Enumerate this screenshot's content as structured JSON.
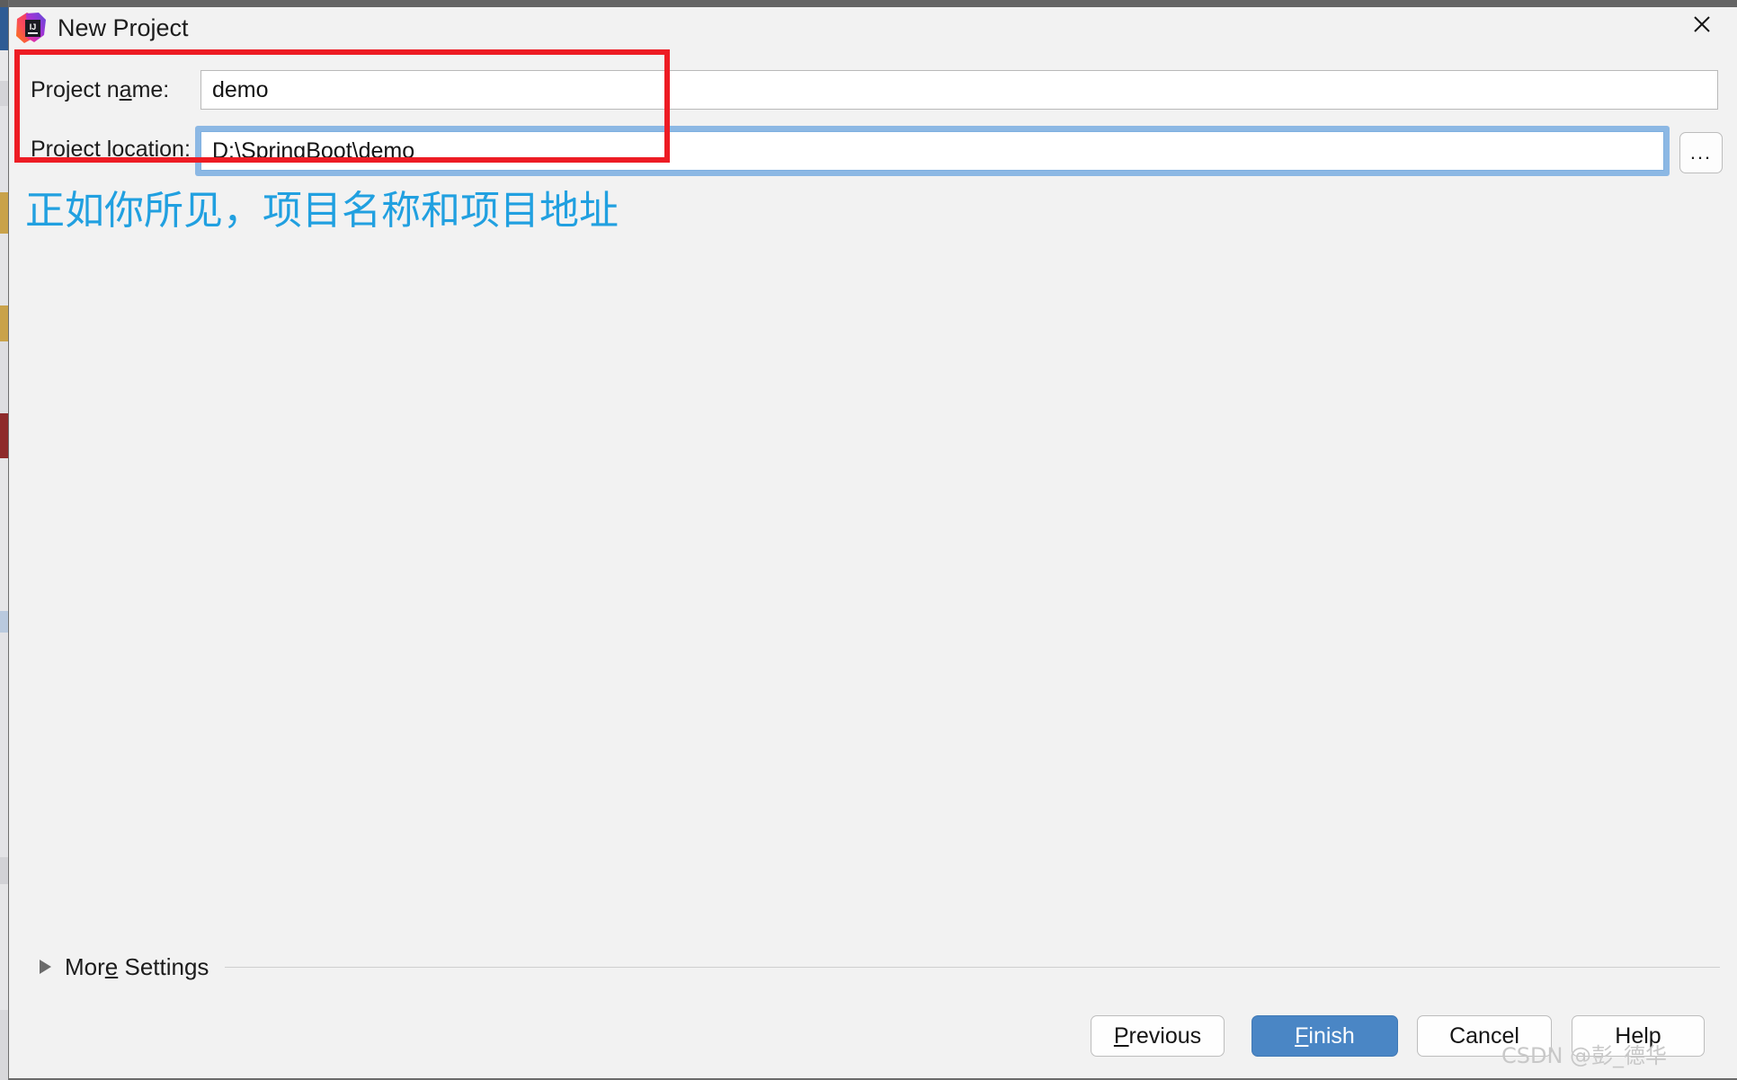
{
  "window": {
    "title": "New Project",
    "app_icon": "intellij-idea-logo",
    "close_icon": "close-icon"
  },
  "form": {
    "project_name": {
      "label_pre": "Project n",
      "label_mnemonic": "a",
      "label_post": "me:",
      "value": "demo",
      "placeholder": ""
    },
    "project_location": {
      "label_pre": "Project ",
      "label_mnemonic": "l",
      "label_post": "ocation:",
      "value": "D:\\SpringBoot\\demo",
      "placeholder": "",
      "browse_label": "...",
      "browse_icon": "ellipsis-icon"
    }
  },
  "annotation": {
    "note_text": "正如你所见，项目名称和项目地址",
    "note_color": "#21a0e0",
    "box_color": "#ed1c24"
  },
  "more_settings": {
    "label_pre": "Mor",
    "label_mnemonic": "e",
    "label_post": " Settings",
    "expander_icon": "chevron-right-icon",
    "expanded": false
  },
  "buttons": {
    "previous": {
      "mnemonic": "P",
      "rest": "revious"
    },
    "finish": {
      "mnemonic": "F",
      "rest": "inish",
      "primary": true,
      "color": "#4a86c5"
    },
    "cancel": {
      "label": "Cancel"
    },
    "help": {
      "label": "Help"
    }
  },
  "watermark": {
    "text": "CSDN @彭_德华"
  }
}
